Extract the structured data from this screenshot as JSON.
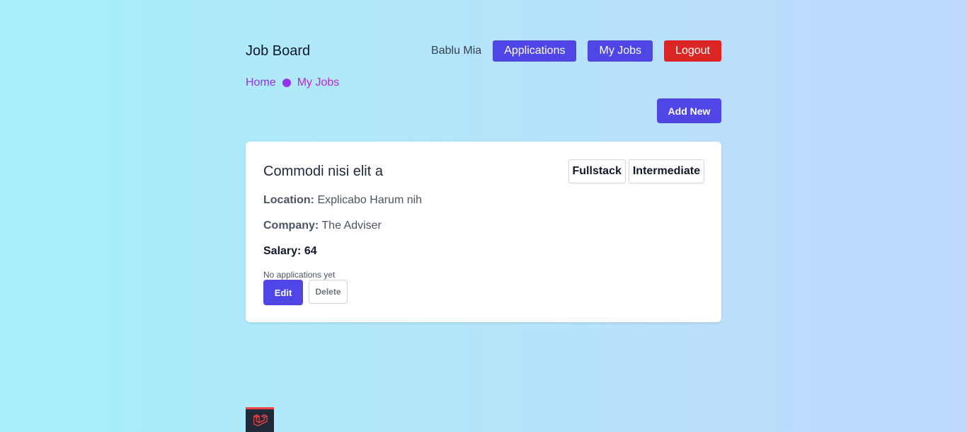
{
  "header": {
    "brand": "Job Board",
    "user_name": "Bablu Mia",
    "applications_label": "Applications",
    "my_jobs_label": "My Jobs",
    "logout_label": "Logout"
  },
  "breadcrumb": {
    "home": "Home",
    "current": "My Jobs"
  },
  "actions": {
    "add_new": "Add New"
  },
  "job": {
    "title": "Commodi nisi elit a",
    "tags": [
      "Fullstack",
      "Intermediate"
    ],
    "location_label": "Location:",
    "location": "Explicabo Harum nih",
    "company_label": "Company:",
    "company": "The Adviser",
    "salary_label": "Salary:",
    "salary": "64",
    "applications_status": "No applications yet",
    "edit_label": "Edit",
    "delete_label": "Delete"
  },
  "colors": {
    "primary": "#4f46e5",
    "danger": "#dc2626",
    "breadcrumb": "#9333ea"
  },
  "icons": {
    "footer": "laravel-logo-icon"
  }
}
